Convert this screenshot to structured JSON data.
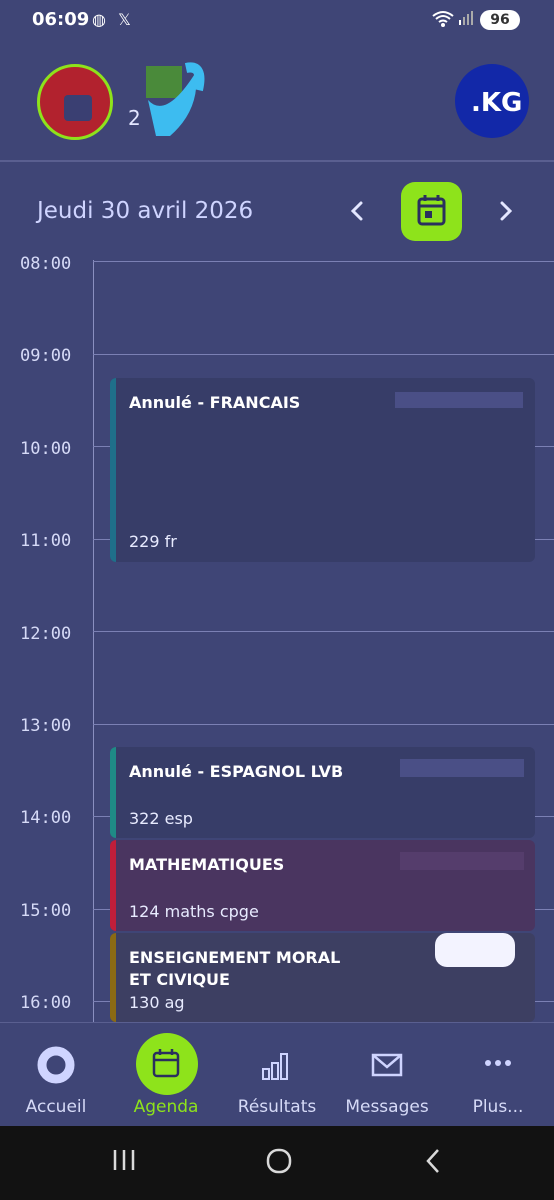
{
  "status_bar": {
    "time": "06:09",
    "battery": "96"
  },
  "header": {
    "subtitle": "2"
  },
  "date_nav": {
    "date_label": "Jeudi 30 avril 2026"
  },
  "hours": [
    "08:00",
    "09:00",
    "10:00",
    "11:00",
    "12:00",
    "13:00",
    "14:00",
    "15:00",
    "16:00"
  ],
  "events": [
    {
      "title": "Annulé - FRANCAIS",
      "room": "229 fr",
      "teacher": "",
      "color": "#1f6f8a"
    },
    {
      "title": "Annulé - ESPAGNOL LVB",
      "room": "322 esp",
      "teacher": "",
      "color": "#1f8a86"
    },
    {
      "title": "MATHEMATIQUES",
      "room": "124 maths cpge",
      "teacher": "",
      "color": "#c01e3a"
    },
    {
      "title": "ENSEIGNEMENT MORAL ET CIVIQUE",
      "room": "130 ag",
      "teacher": "",
      "color": "#8a6a14"
    }
  ],
  "bottom_nav": [
    {
      "label": "Accueil",
      "icon": "home-ring-icon"
    },
    {
      "label": "Agenda",
      "icon": "calendar-icon",
      "active": true
    },
    {
      "label": "Résultats",
      "icon": "bar-chart-icon"
    },
    {
      "label": "Messages",
      "icon": "envelope-icon"
    },
    {
      "label": "Plus...",
      "icon": "more-dots-icon"
    }
  ],
  "colors": {
    "accent": "#8ee31b",
    "background": "#3f4576"
  }
}
